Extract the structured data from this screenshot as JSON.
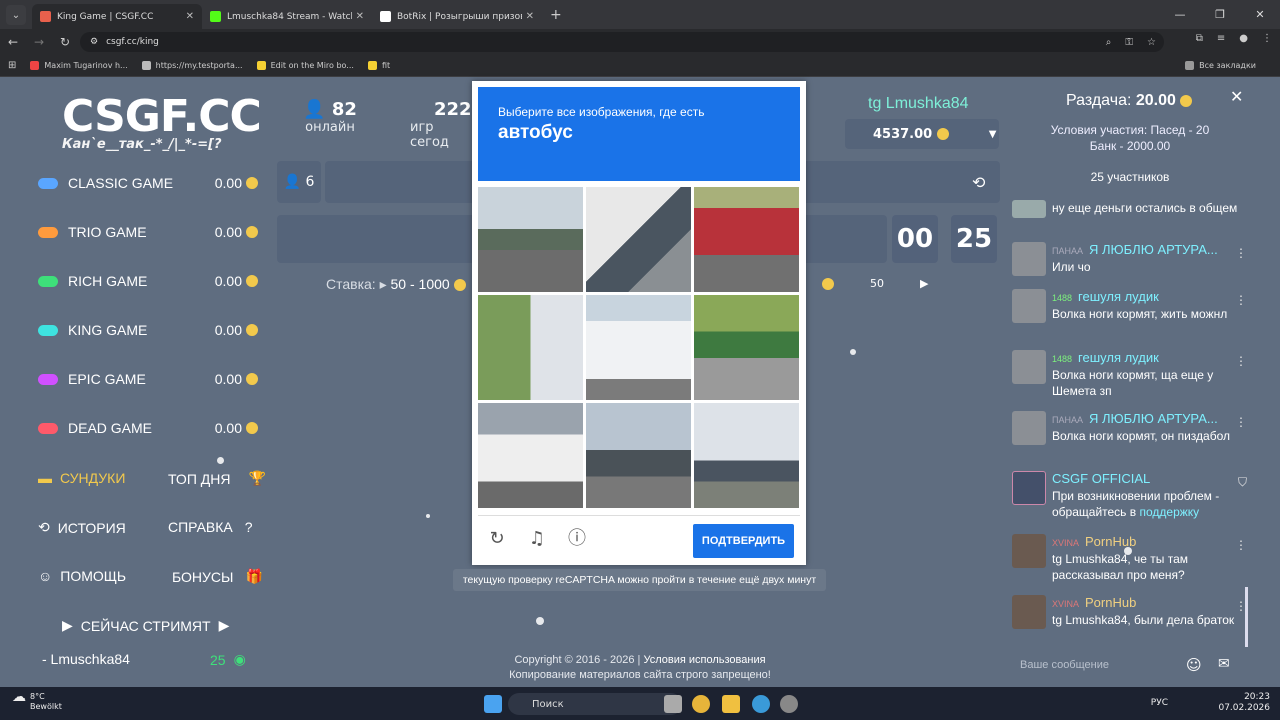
{
  "browser": {
    "tabs": [
      {
        "title": "King Game | CSGF.CC",
        "active": true,
        "color": "#e8604c"
      },
      {
        "title": "Lmuschka84 Stream - Watch Li",
        "active": false,
        "color": "#53fc18"
      },
      {
        "title": "BotRix | Розыгрыши призов",
        "active": false,
        "color": "#ffffff"
      }
    ],
    "url": "csgf.cc/king",
    "bookmarks": [
      "Maxim Tugarinov h...",
      "https://my.testporta...",
      "Edit on the Miro bo...",
      "fit"
    ],
    "all_bookmarks": "Все закладки"
  },
  "site": {
    "logo": "CSGF.CC",
    "logo_sub": "Кан`е__так_-*_/|_*-=[?",
    "online_count": "82",
    "online_label": "онлайн",
    "games_count": "2221",
    "games_label": "игр сегод",
    "players_count": "6",
    "stake_label": "Ставка:",
    "stake_range": "50 - 1000",
    "stake_value": "50",
    "timer_min": "00",
    "timer_sec": "25",
    "games": [
      {
        "name": "CLASSIC GAME",
        "value": "0.00",
        "color": "#5aa6ff"
      },
      {
        "name": "TRIO GAME",
        "value": "0.00",
        "color": "#ff9b3d"
      },
      {
        "name": "RICH GAME",
        "value": "0.00",
        "color": "#3ee07a"
      },
      {
        "name": "KING GAME",
        "value": "0.00",
        "color": "#3ee3e0"
      },
      {
        "name": "EPIC GAME",
        "value": "0.00",
        "color": "#d050ff"
      },
      {
        "name": "DEAD GAME",
        "value": "0.00",
        "color": "#ff5a6a"
      }
    ],
    "menu": {
      "chests": "СУНДУКИ",
      "top_day": "ТОП ДНЯ",
      "history": "ИСТОРИЯ",
      "help_ref": "СПРАВКА",
      "support": "ПОМОЩЬ",
      "bonuses": "БОНУСЫ",
      "streaming": "СЕЙЧАС СТРИМЯТ",
      "streamer": "- Lmuschka84",
      "streamer_viewers": "25"
    },
    "user": {
      "name": "tg Lmushka84",
      "balance": "4537.00"
    },
    "footer_copyright": "Copyright © 2016 - 2026 |",
    "footer_terms": "Условия использования",
    "footer_note": "Копирование материалов сайта строго запрещено!"
  },
  "giveaway": {
    "label": "Раздача:",
    "amount": "20.00",
    "conditions": "Условия участия: Пасед - 20",
    "bank": "Банк - 2000.00",
    "participants": "25 участников"
  },
  "chat": {
    "messages": [
      {
        "badge": "",
        "name": "",
        "text": "ну еще деньги остались в общем",
        "name_color": "#fff"
      },
      {
        "badge": "ПАНАА",
        "name": "Я ЛЮБЛЮ АРТУРА...",
        "text": "Или чо",
        "name_color": "#7ef0ff"
      },
      {
        "badge": "1488",
        "name": "гешуля лудик",
        "text": "Волка ноги кормят, жить можнл",
        "name_color": "#7ef0ff"
      },
      {
        "badge": "1488",
        "name": "гешуля лудик",
        "text": "Волка ноги кормят, ща еще у Шемета зп",
        "name_color": "#7ef0ff"
      },
      {
        "badge": "ПАНАА",
        "name": "Я ЛЮБЛЮ АРТУРА...",
        "text": "Волка ноги кормят, он пиздабол",
        "name_color": "#7ef0ff"
      },
      {
        "badge": "",
        "name": "CSGF OFFICIAL",
        "text": "При возникновении проблем - обращайтесь в",
        "link": "поддержку",
        "name_color": "#7ef0ff"
      },
      {
        "badge": "XVINA",
        "name": "PornHub",
        "text": "tg Lmushka84, че ты там рассказывал про меня?",
        "name_color": "#f0d080"
      },
      {
        "badge": "XVINA",
        "name": "PornHub",
        "text": "tg Lmushka84, были дела браток",
        "name_color": "#f0d080"
      }
    ],
    "input_placeholder": "Ваше сообщение"
  },
  "captcha": {
    "instruction": "Выберите все изображения, где есть",
    "target": "автобус",
    "verify_label": "ПОДТВЕРДИТЬ",
    "tooltip": "текущую проверку reCAPTCHA можно пройти в течение ещё двух минут"
  },
  "taskbar": {
    "temp": "8°C",
    "weather": "Bewölkt",
    "search": "Поиск",
    "lang": "РУС",
    "time": "20:23",
    "date": "07.02.2026"
  }
}
